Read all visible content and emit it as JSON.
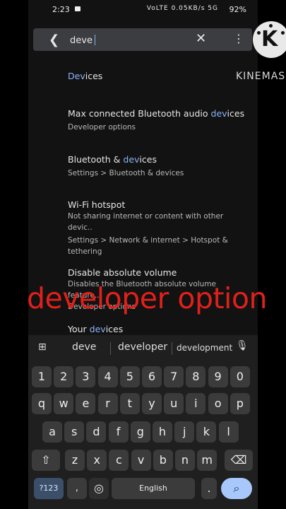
{
  "status_bar": {
    "time": "2:23",
    "network_icons": "VoLTE 0.05KB/s 5G",
    "battery": "92%"
  },
  "search": {
    "query": "deve",
    "back_icon": "arrow-left-icon",
    "clear_icon": "close-icon",
    "more_icon": "more-vert-icon"
  },
  "results": [
    {
      "title_pre": "",
      "title_hl": "Dev",
      "title_post": "ices",
      "subtitle": ""
    },
    {
      "title_pre": "Max connected Bluetooth audio ",
      "title_hl": "dev",
      "title_post": "ices",
      "subtitle": "Developer options"
    },
    {
      "title_pre": "Bluetooth & ",
      "title_hl": "dev",
      "title_post": "ices",
      "subtitle": "Settings > Bluetooth & devices"
    },
    {
      "title_pre": "Wi-Fi hotspot",
      "title_hl": "",
      "title_post": "",
      "subtitle": "Not sharing internet or content with other devic..",
      "subtitle2": "Settings > Network & internet > Hotspot & tethering"
    },
    {
      "title_pre": "Disable absolute volume",
      "title_hl": "",
      "title_post": "",
      "subtitle": "Disables the Bluetooth absolute volume feature..",
      "subtitle2": "Developer options"
    },
    {
      "title_pre": "Your ",
      "title_hl": "dev",
      "title_post": "ices",
      "subtitle": ""
    }
  ],
  "overlay": {
    "caption": "developer option",
    "brand": "KINEMAS",
    "caption_color": "#e0201a"
  },
  "keyboard": {
    "suggestions": [
      "deve",
      "developer",
      "development"
    ],
    "row_numbers": [
      "1",
      "2",
      "3",
      "4",
      "5",
      "6",
      "7",
      "8",
      "9",
      "0"
    ],
    "row1": [
      "q",
      "w",
      "e",
      "r",
      "t",
      "y",
      "u",
      "i",
      "o",
      "p"
    ],
    "row2": [
      "a",
      "s",
      "d",
      "f",
      "g",
      "h",
      "j",
      "k",
      "l"
    ],
    "row3": [
      "z",
      "x",
      "c",
      "v",
      "b",
      "n",
      "m"
    ],
    "symbols_label": "?123",
    "emoji_label": "☺",
    "comma_label": ",",
    "space_label": "English",
    "period_label": ".",
    "shift_icon": "shift-icon",
    "delete_icon": "backspace-icon",
    "search_icon": "search-icon",
    "globe_icon": "globe-icon",
    "grid_icon": "apps-grid-icon",
    "mic_icon": "mic-icon"
  },
  "colors": {
    "highlight": "#8ab4f8",
    "action_key": "#a8c7fa"
  }
}
